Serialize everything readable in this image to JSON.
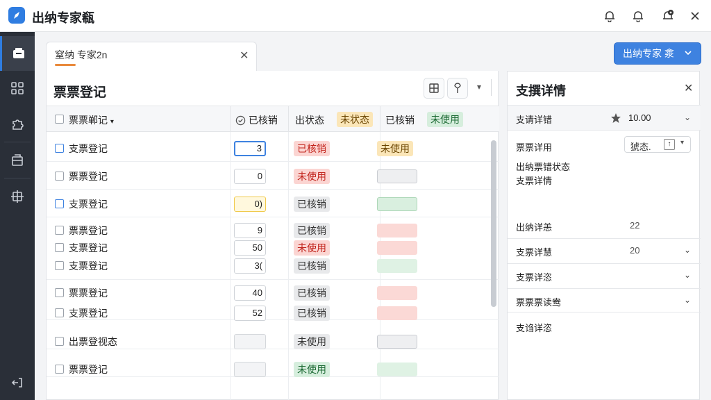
{
  "app": {
    "title": "出纳专家瓻"
  },
  "tab": {
    "label": "窒纳 专家2n"
  },
  "header": {
    "primary_button": "出纳专家 淾"
  },
  "panel": {
    "title": "票票登记"
  },
  "table": {
    "headers": {
      "name": "票票郸记",
      "col2": "已核销",
      "col3": "出状态",
      "col4a": "未状态",
      "col4b": "已核销",
      "col4c": "未使用"
    },
    "rows": [
      {
        "label": "支票登记",
        "num": "3",
        "status": "已核销",
        "status_color": "red",
        "tag": "未使用",
        "tag_kind": "yellow"
      },
      {
        "label": "票票登记",
        "num": "0",
        "status": "未使用",
        "status_color": "red",
        "tag": "",
        "tag_kind": "gray"
      },
      {
        "label": "支票登记",
        "num": "0)",
        "status": "已核销",
        "status_color": "gray",
        "tag": "",
        "tag_kind": "green"
      },
      {
        "label": "票票登记",
        "num": "9",
        "status": "已核销",
        "status_color": "gray",
        "tag": "",
        "tag_kind": "red"
      },
      {
        "label": "支票登记",
        "num": "50",
        "status": "未使用",
        "status_color": "red",
        "tag": "",
        "tag_kind": "red"
      },
      {
        "label": "支票登记",
        "num": "3(",
        "status": "已核销",
        "status_color": "gray",
        "tag": "",
        "tag_kind": "pgreen"
      },
      {
        "label": "票票登记",
        "num": "40",
        "status": "已核销",
        "status_color": "gray",
        "tag": "",
        "tag_kind": "red"
      },
      {
        "label": "支票登记",
        "num": "52",
        "status": "已核销",
        "status_color": "gray",
        "tag": "",
        "tag_kind": "red"
      },
      {
        "label": "出票登视态",
        "num": "",
        "status": "未使用",
        "status_color": "gray",
        "tag": "",
        "tag_kind": "gray"
      },
      {
        "label": "票票登记",
        "num": "",
        "status": "未使用",
        "status_color": "green",
        "tag": "",
        "tag_kind": "pgreen"
      }
    ]
  },
  "detail": {
    "title": "支撰详情",
    "sec1": {
      "label": "支请详错",
      "value": "10.00"
    },
    "f1": {
      "label": "票票详用",
      "select": "猇态."
    },
    "f2": {
      "label1": "出纳票错状态",
      "label2": "支票详情"
    },
    "f3": {
      "label": "出纳详恙",
      "value": "22"
    },
    "f4": {
      "label": "支票详慧",
      "value": "20"
    },
    "f5": {
      "label": "支票详恣"
    },
    "f6": {
      "label": "票票票读鸯"
    },
    "f7": {
      "label": "支诌详恣"
    }
  },
  "colors": {
    "accent": "#3e82e0",
    "sidebar": "#2a2f38",
    "badge_red": "#fbd5d2",
    "badge_yellow": "#fbe6b8",
    "badge_green": "#d6eedd"
  }
}
